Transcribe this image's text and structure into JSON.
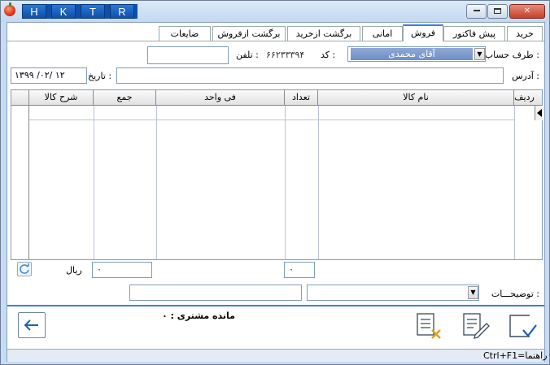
{
  "titlebar": {
    "hotkeys": [
      "H",
      "K",
      "T",
      "R"
    ]
  },
  "tabs": [
    {
      "label": "خرید"
    },
    {
      "label": "پیش فاکتور"
    },
    {
      "label": "فروش"
    },
    {
      "label": "امانی"
    },
    {
      "label": "برگشت ازخرید"
    },
    {
      "label": "برگشت ازفروش"
    },
    {
      "label": "ضایعات"
    }
  ],
  "active_tab": "فروش",
  "form": {
    "account_label": "طرف حساب :",
    "account_value": "آقای محمدی",
    "code_label": "کد :",
    "code_value": "۶۶۲۳۳۳۹۴",
    "phone_label": "تلفن :",
    "phone_value": "",
    "address_label": "آدرس :",
    "address_value": "",
    "date_label": "تاریخ :",
    "date_value": "۱۳۹۹ /۰۲/ ۱۲"
  },
  "grid": {
    "columns": [
      "ردیف",
      "نام کالا",
      "تعداد",
      "فی واحد",
      "جمع",
      "شرح کالا"
    ]
  },
  "totals": {
    "rial_label": "ریال",
    "sum_value": "۰",
    "count_value": "۰"
  },
  "notes": {
    "label": "توضیحـــات :",
    "value": "",
    "extra": ""
  },
  "balance": {
    "label": "مانده مشتری : ۰"
  },
  "status": {
    "help": "Ctrl+F1=راهنما"
  },
  "colors": {
    "accent": "#3b7de0",
    "title_bg": "#c6dcf4",
    "hotkey_bg": "#0f4fa8",
    "close": "#c4412c"
  }
}
